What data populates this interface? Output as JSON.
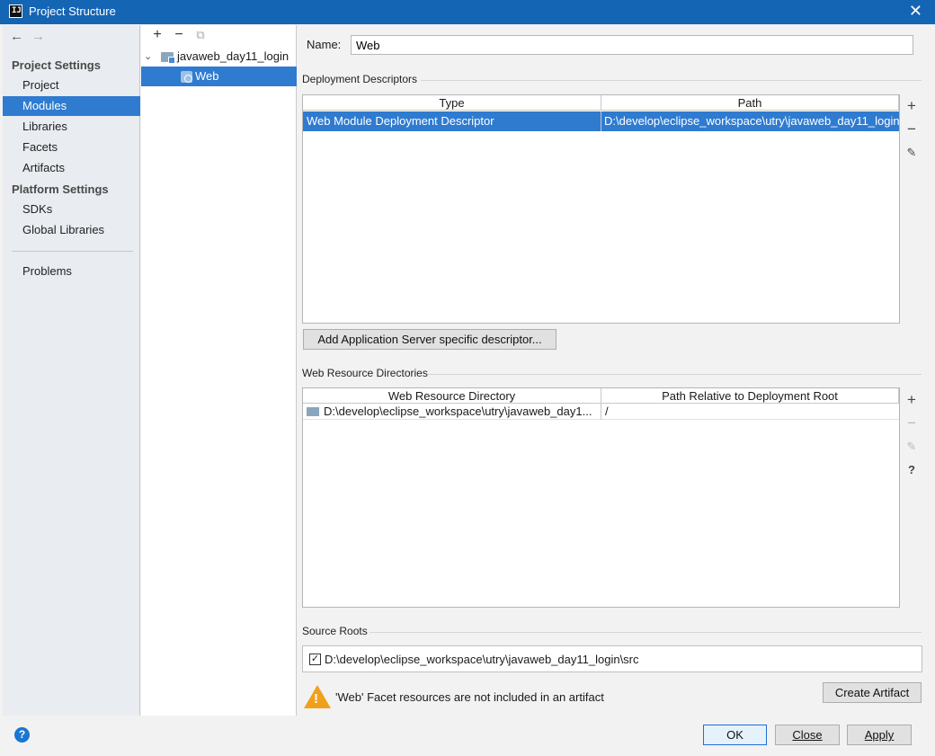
{
  "window": {
    "app_icon": "IJ",
    "title": "Project Structure",
    "close_glyph": "✕"
  },
  "nav": {
    "back": "←",
    "forward": "→",
    "project_settings_header": "Project Settings",
    "platform_settings_header": "Platform Settings",
    "items": {
      "project": "Project",
      "modules": "Modules",
      "libraries": "Libraries",
      "facets": "Facets",
      "artifacts": "Artifacts",
      "sdks": "SDKs",
      "global_libraries": "Global Libraries",
      "problems": "Problems"
    }
  },
  "module_tree": {
    "toolbar": {
      "add": "+",
      "remove": "−",
      "copy": "⧉"
    },
    "nodes": [
      {
        "label": "javaweb_day11_login",
        "expanded": true
      },
      {
        "label": "Web",
        "selected": true
      }
    ]
  },
  "facet": {
    "name_label": "Name:",
    "name_value": "Web",
    "deployment_descriptors": {
      "title": "Deployment Descriptors",
      "columns": [
        "Type",
        "Path"
      ],
      "rows": [
        {
          "type": "Web Module Deployment Descriptor",
          "path": "D:\\develop\\eclipse_workspace\\utry\\javaweb_day11_login"
        }
      ],
      "add_server_button": "Add Application Server specific descriptor..."
    },
    "web_resource_directories": {
      "title": "Web Resource Directories",
      "columns": [
        "Web Resource Directory",
        "Path Relative to Deployment Root"
      ],
      "rows": [
        {
          "directory": "D:\\develop\\eclipse_workspace\\utry\\javaweb_day1...",
          "relative_path": "/"
        }
      ]
    },
    "source_roots": {
      "title": "Source Roots",
      "items": [
        {
          "checked": true,
          "check_glyph": "✓",
          "path": "D:\\develop\\eclipse_workspace\\utry\\javaweb_day11_login\\src"
        }
      ]
    },
    "warning": {
      "mark": "!",
      "text": "'Web' Facet resources are not included in an artifact"
    },
    "create_artifact_button": "Create Artifact"
  },
  "tools": {
    "add": "+",
    "remove": "−",
    "edit": "✎",
    "help": "?"
  },
  "footer": {
    "help": "?",
    "ok": "OK",
    "close": "Close",
    "apply": "Apply"
  },
  "colors": {
    "title_bar": "#1565b5",
    "selection": "#2f7bd0",
    "warning": "#f0a11c"
  }
}
